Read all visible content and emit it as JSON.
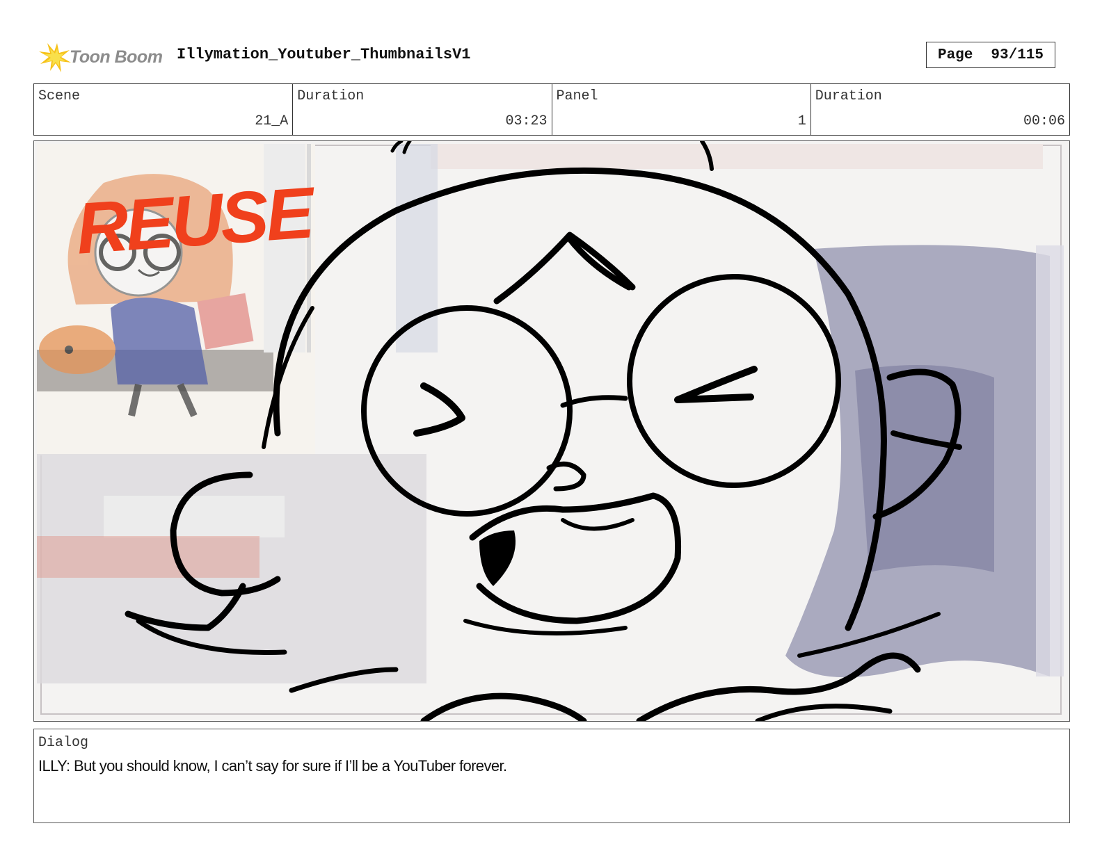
{
  "header": {
    "logo_text": "Toon Boom",
    "project_title": "Illymation_Youtuber_ThumbnailsV1",
    "page_label": "Page",
    "page_value": "93/115"
  },
  "info": {
    "scene_label": "Scene",
    "scene_value": "21_A",
    "scene_duration_label": "Duration",
    "scene_duration_value": "03:23",
    "panel_label": "Panel",
    "panel_value": "1",
    "panel_duration_label": "Duration",
    "panel_duration_value": "00:06"
  },
  "panel_image": {
    "stamp_text": "REUSE",
    "stamp_color": "#f0401c"
  },
  "dialog": {
    "label": "Dialog",
    "text": "ILLY: But you should know, I can’t say for sure if I’ll be a YouTuber forever."
  }
}
